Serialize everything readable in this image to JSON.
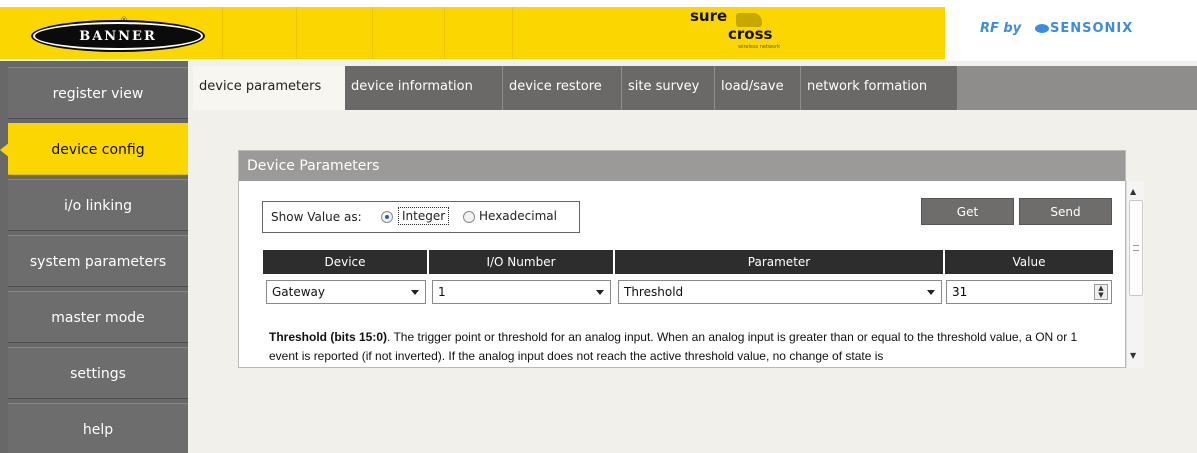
{
  "header": {
    "banner_logo": "BANNER",
    "banner_reg": "®",
    "surecross_top": "sure",
    "surecross_bottom": "cross",
    "surecross_tag": "wireless network",
    "rf_by": "RF by",
    "sensonix": "SENSONIX"
  },
  "sidebar": {
    "items": [
      {
        "label": "register view"
      },
      {
        "label": "device config"
      },
      {
        "label": "i/o linking"
      },
      {
        "label": "system parameters"
      },
      {
        "label": "master mode"
      },
      {
        "label": "settings"
      },
      {
        "label": "help"
      }
    ],
    "active": "device config"
  },
  "tabs": [
    {
      "label": "device parameters"
    },
    {
      "label": "device information"
    },
    {
      "label": "device restore"
    },
    {
      "label": "site survey"
    },
    {
      "label": "load/save"
    },
    {
      "label": "network formation"
    }
  ],
  "panel": {
    "title": "Device Parameters",
    "show_value_label": "Show Value as:",
    "option_integer": "Integer",
    "option_hex": "Hexadecimal",
    "selected_option": "Integer",
    "get_label": "Get",
    "send_label": "Send",
    "columns": [
      "Device",
      "I/O Number",
      "Parameter",
      "Value"
    ],
    "row": {
      "device": "Gateway",
      "io_number": "1",
      "parameter": "Threshold",
      "value": "31"
    },
    "desc_bold": "Threshold (bits 15:0)",
    "desc_text": ". The trigger point or threshold for an analog input. When an analog input is greater than or equal to the threshold value, a ON or 1 event is reported (if not inverted). If the analog input does not reach the active threshold value, no change of state is"
  }
}
